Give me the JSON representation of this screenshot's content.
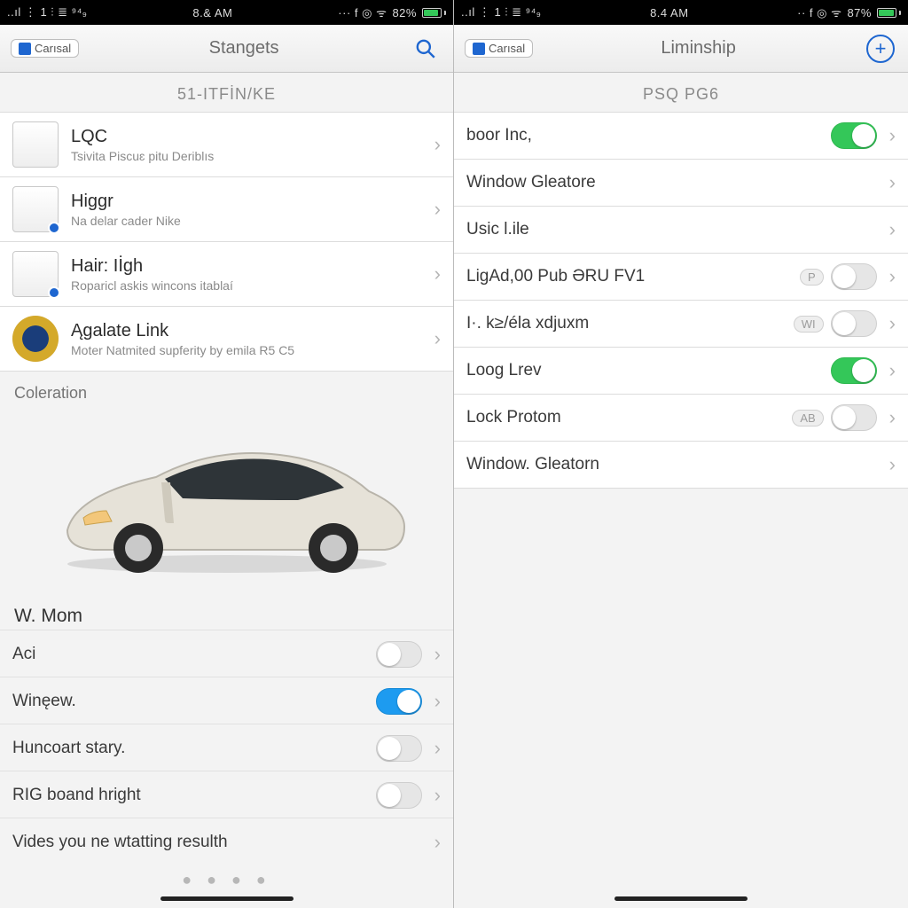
{
  "left": {
    "status": {
      "carrier_glyphs": "..ıl  ⋮ 1 ⫶  ≣  ⁹⁴₉",
      "time": "8.& AM",
      "right_glyphs": "··· f ◎ ᯤ",
      "battery_pct": "82%",
      "battery_fill_pct": 82
    },
    "header": {
      "brand": "Carısal",
      "title": "Stangets"
    },
    "subhead": "51-ITFİN/KE",
    "thumb_items": [
      {
        "title": "LQC",
        "sub": "Tsivita Piscuɛ pitu Deriblıs",
        "icon": "plant",
        "badge": false
      },
      {
        "title": "Higgr",
        "sub": "Na delar cader Nike",
        "icon": "key",
        "badge": true
      },
      {
        "title": "Hair: Iİgh",
        "sub": "Roparicl askis wincons itablaí",
        "icon": "key",
        "badge": true
      },
      {
        "title": "Ągalate Link",
        "sub": "Moter Natmited supferity by emila R5 C5",
        "icon": "seal",
        "badge": false
      }
    ],
    "section_label": "Coleration",
    "bottom_head": "W. Mom",
    "settings": [
      {
        "label": "Aci",
        "toggle": "off"
      },
      {
        "label": "Winęew.",
        "toggle": "on-blue"
      },
      {
        "label": "Huncoart stary.",
        "toggle": "off"
      },
      {
        "label": "RIG boand hright",
        "toggle": "off"
      },
      {
        "label": "Vides you ne wtatting resulth",
        "toggle": null
      }
    ],
    "page_dots": "● ● ● ●"
  },
  "right": {
    "status": {
      "carrier_glyphs": "..ıl  ⋮ 1 ⫶  ≣  ⁹⁴₉",
      "time": "8.4 AM",
      "right_glyphs": "·· f ◎ ᯤ",
      "battery_pct": "87%",
      "battery_fill_pct": 87
    },
    "header": {
      "brand": "Carısal",
      "title": "Liminship"
    },
    "subhead": "PSQ PG6",
    "settings": [
      {
        "label": "boor Inc,",
        "toggle": "on-green",
        "pill": null
      },
      {
        "label": "Window Gleatore",
        "toggle": null,
        "pill": null
      },
      {
        "label": "Usic l.ile",
        "toggle": null,
        "pill": null
      },
      {
        "label": "LigAd,00 Pub ƏRU FV1",
        "toggle": "off",
        "pill": "P"
      },
      {
        "label": "I·. k≥/éla xdjuxm",
        "toggle": "off",
        "pill": "WI"
      },
      {
        "label": "Loog Lrev",
        "toggle": "on-green",
        "pill": null
      },
      {
        "label": "Lock Protom",
        "toggle": "off",
        "pill": "AB"
      },
      {
        "label": "Window. Gleatorn",
        "toggle": null,
        "pill": null
      }
    ]
  }
}
